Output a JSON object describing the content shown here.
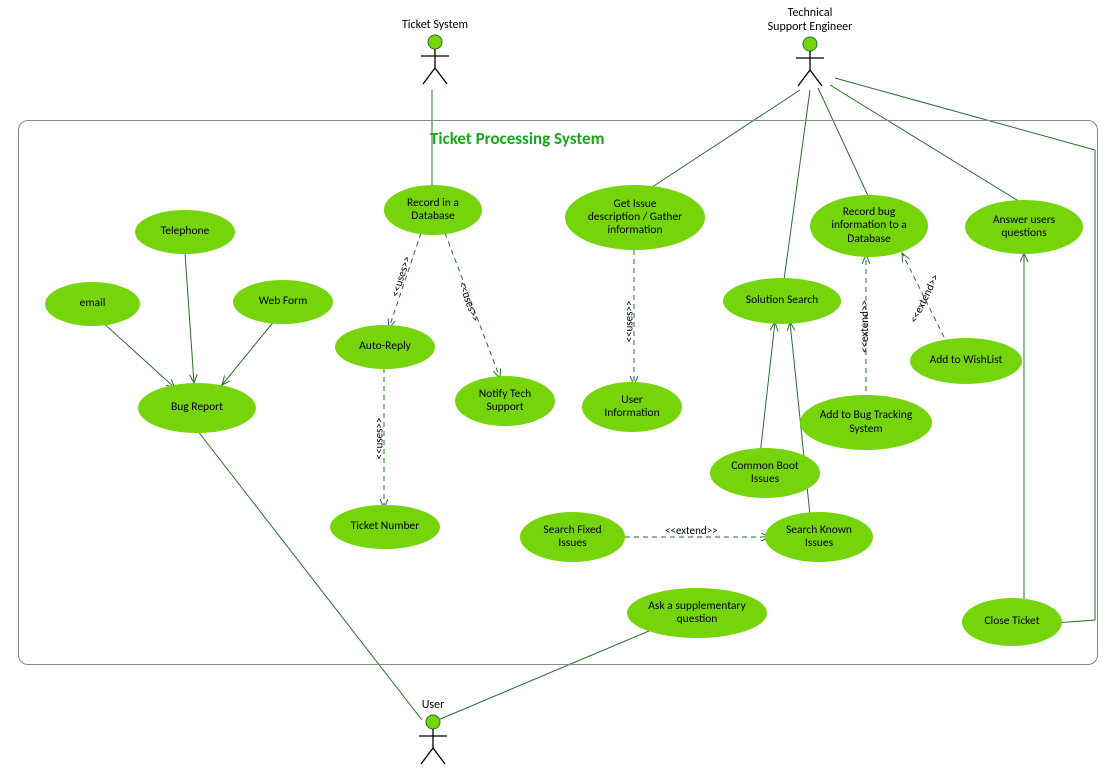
{
  "title": "Ticket Processing System",
  "actors": {
    "ticket_system": "Ticket System",
    "support_engineer": "Technical\nSupport Engineer",
    "user": "User"
  },
  "usecases": {
    "bug_report": "Bug Report",
    "email": "email",
    "telephone": "Telephone",
    "web_form": "Web Form",
    "record_db": "Record in a\nDatabase",
    "auto_reply": "Auto-Reply",
    "notify_tech": "Notify Tech\nSupport",
    "ticket_number": "Ticket Number",
    "get_issue": "Get Issue\ndescription / Gather\ninformation",
    "user_info": "User\nInformation",
    "solution_search": "Solution Search",
    "common_boot": "Common Boot\nIssues",
    "search_fixed": "Search Fixed\nIssues",
    "search_known": "Search Known\nIssues",
    "ask_supp": "Ask a supplementary\nquestion",
    "record_bug_db": "Record bug\ninformation to a\nDatabase",
    "add_bug_track": "Add to Bug Tracking\nSystem",
    "add_wishlist": "Add to WishList",
    "answer_users": "Answer users\nquestions",
    "close_ticket": "Close Ticket"
  },
  "labels": {
    "uses": "<<uses>>",
    "extend": "<<extend>>"
  },
  "chart_data": {
    "type": "table",
    "diagram_type": "UML Use Case Diagram",
    "system": "Ticket Processing System",
    "actors": [
      "Ticket System",
      "Technical Support Engineer",
      "User"
    ],
    "use_cases": [
      "Bug Report",
      "email",
      "Telephone",
      "Web Form",
      "Record in a Database",
      "Auto-Reply",
      "Notify Tech Support",
      "Ticket Number",
      "Get Issue description / Gather information",
      "User Information",
      "Solution Search",
      "Common Boot Issues",
      "Search Fixed Issues",
      "Search Known Issues",
      "Ask a supplementary question",
      "Record bug information to a Database",
      "Add to Bug Tracking System",
      "Add to WishList",
      "Answer users questions",
      "Close Ticket"
    ],
    "associations": [
      {
        "from": "Ticket System",
        "to": "Record in a Database"
      },
      {
        "from": "Technical Support Engineer",
        "to": "Get Issue description / Gather information"
      },
      {
        "from": "Technical Support Engineer",
        "to": "Solution Search"
      },
      {
        "from": "Technical Support Engineer",
        "to": "Record bug information to a Database"
      },
      {
        "from": "Technical Support Engineer",
        "to": "Answer users questions"
      },
      {
        "from": "Technical Support Engineer",
        "to": "Close Ticket"
      },
      {
        "from": "User",
        "to": "Bug Report"
      },
      {
        "from": "User",
        "to": "Ask a supplementary question"
      },
      {
        "from": "email",
        "to": "Bug Report"
      },
      {
        "from": "Telephone",
        "to": "Bug Report"
      },
      {
        "from": "Web Form",
        "to": "Bug Report"
      },
      {
        "from": "Common Boot Issues",
        "to": "Solution Search"
      },
      {
        "from": "Search Known Issues",
        "to": "Solution Search"
      },
      {
        "from": "Close Ticket",
        "to": "Answer users questions"
      }
    ],
    "uses_dependencies": [
      {
        "from": "Record in a Database",
        "to": "Auto-Reply"
      },
      {
        "from": "Record in a Database",
        "to": "Notify Tech Support"
      },
      {
        "from": "Auto-Reply",
        "to": "Ticket Number"
      },
      {
        "from": "Get Issue description / Gather information",
        "to": "User Information"
      }
    ],
    "extend_dependencies": [
      {
        "from": "Search Fixed Issues",
        "to": "Search Known Issues"
      },
      {
        "from": "Add to Bug Tracking System",
        "to": "Record bug information to a Database"
      },
      {
        "from": "Add to WishList",
        "to": "Record bug information to a Database"
      }
    ]
  }
}
